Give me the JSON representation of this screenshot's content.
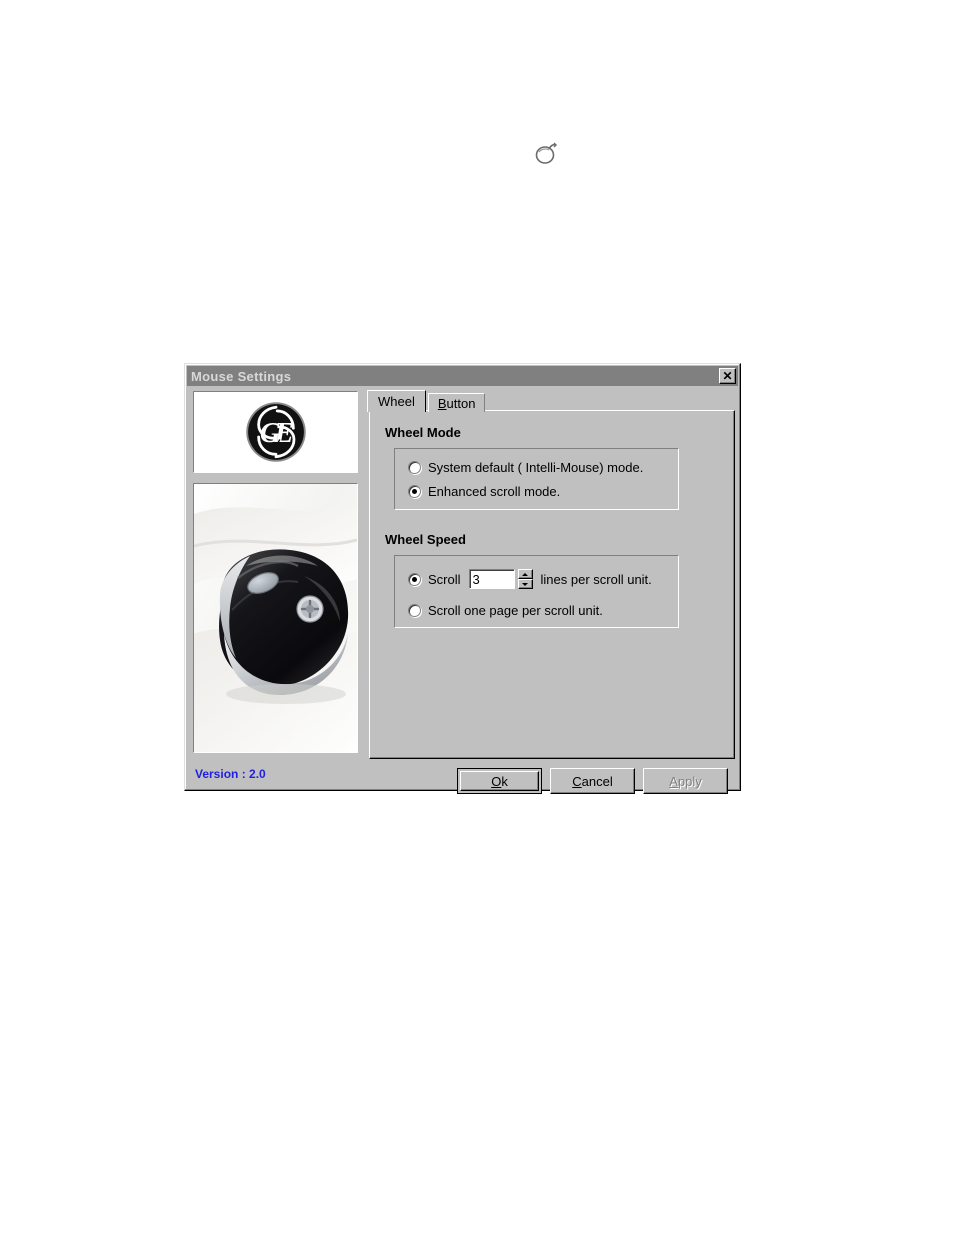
{
  "page": {
    "background": "#ffffff",
    "decorative_icon": "mouse-icon"
  },
  "dialog": {
    "title": "Mouse Settings",
    "titlebar_color": "#808080",
    "face_color": "#c0c0c0",
    "close_button_glyph": "✕",
    "close_button_name": "close-icon"
  },
  "left_panel": {
    "logo_alt": "ge-logo",
    "product_image_alt": "mouse-product-photo",
    "version_text": "Version : 2.0",
    "version_color": "#2020e0"
  },
  "tabs": [
    {
      "label": "Wheel",
      "accel": "",
      "active": true
    },
    {
      "label": "Button",
      "accel": "B",
      "active": false
    }
  ],
  "wheel_tab": {
    "wheel_mode": {
      "title": "Wheel Mode",
      "options": [
        {
          "label": "System default ( Intelli-Mouse) mode.",
          "checked": false
        },
        {
          "label": "Enhanced scroll mode.",
          "checked": true
        }
      ]
    },
    "wheel_speed": {
      "title": "Wheel Speed",
      "scroll_lines_option": {
        "prefix_label": "Scroll",
        "value": "3",
        "suffix_label": "lines per scroll unit.",
        "checked": true
      },
      "scroll_page_option": {
        "label": "Scroll one page per scroll unit.",
        "checked": false
      }
    }
  },
  "buttons": [
    {
      "label_pre": "",
      "accel": "O",
      "label_post": "k",
      "full": "Ok",
      "state": "default"
    },
    {
      "label_pre": "",
      "accel": "C",
      "label_post": "ancel",
      "full": "Cancel",
      "state": "normal"
    },
    {
      "label_pre": "",
      "accel": "A",
      "label_post": "pply",
      "full": "Apply",
      "state": "disabled"
    }
  ]
}
